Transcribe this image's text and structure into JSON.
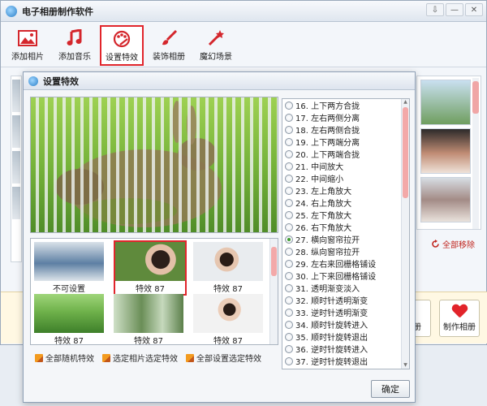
{
  "app": {
    "title": "电子相册制作软件",
    "window_controls": [
      "⇩",
      "—",
      "✕"
    ]
  },
  "toolbar": {
    "items": [
      {
        "label": "添加相片",
        "icon": "photo-icon"
      },
      {
        "label": "添加音乐",
        "icon": "music-note-icon"
      },
      {
        "label": "设置特效",
        "icon": "palette-icon",
        "active": true
      },
      {
        "label": "装饰相册",
        "icon": "brush-icon"
      },
      {
        "label": "魔幻场景",
        "icon": "magic-wand-icon"
      }
    ]
  },
  "main": {
    "remove_all_label": "全部移除",
    "make_album_label": "制作相册",
    "partial_button_label": "相册"
  },
  "dialog": {
    "title": "设置特效",
    "thumbnails": [
      {
        "caption": "不可设置"
      },
      {
        "caption": "特效 87",
        "selected": true
      },
      {
        "caption": "特效 87"
      },
      {
        "caption": "特效 87"
      },
      {
        "caption": "特效 87"
      },
      {
        "caption": "特效 87"
      }
    ],
    "effects": [
      {
        "label": "16. 上下两方合拢"
      },
      {
        "label": "17. 左右两侧分离"
      },
      {
        "label": "18. 左右两侧合拢"
      },
      {
        "label": "19. 上下两端分离"
      },
      {
        "label": "20. 上下两端合拢"
      },
      {
        "label": "21. 中间放大"
      },
      {
        "label": "22. 中间缩小"
      },
      {
        "label": "23. 左上角放大"
      },
      {
        "label": "24. 右上角放大"
      },
      {
        "label": "25. 左下角放大"
      },
      {
        "label": "26. 右下角放大"
      },
      {
        "label": "27. 横向窗帘拉开",
        "selected": true
      },
      {
        "label": "28. 纵向窗帘拉开"
      },
      {
        "label": "29. 左右来回栅格铺设"
      },
      {
        "label": "30. 上下来回栅格铺设"
      },
      {
        "label": "31. 透明渐变淡入"
      },
      {
        "label": "32. 顺时针透明渐变"
      },
      {
        "label": "33. 逆时针透明渐变"
      },
      {
        "label": "34. 顺时针旋转进入"
      },
      {
        "label": "35. 顺时针旋转退出"
      },
      {
        "label": "36. 逆时针旋转进入"
      },
      {
        "label": "37. 逆时针旋转退出"
      }
    ],
    "actions": [
      "全部随机特效",
      "选定相片选定特效",
      "全部设置选定特效"
    ],
    "ok_label": "确定"
  }
}
